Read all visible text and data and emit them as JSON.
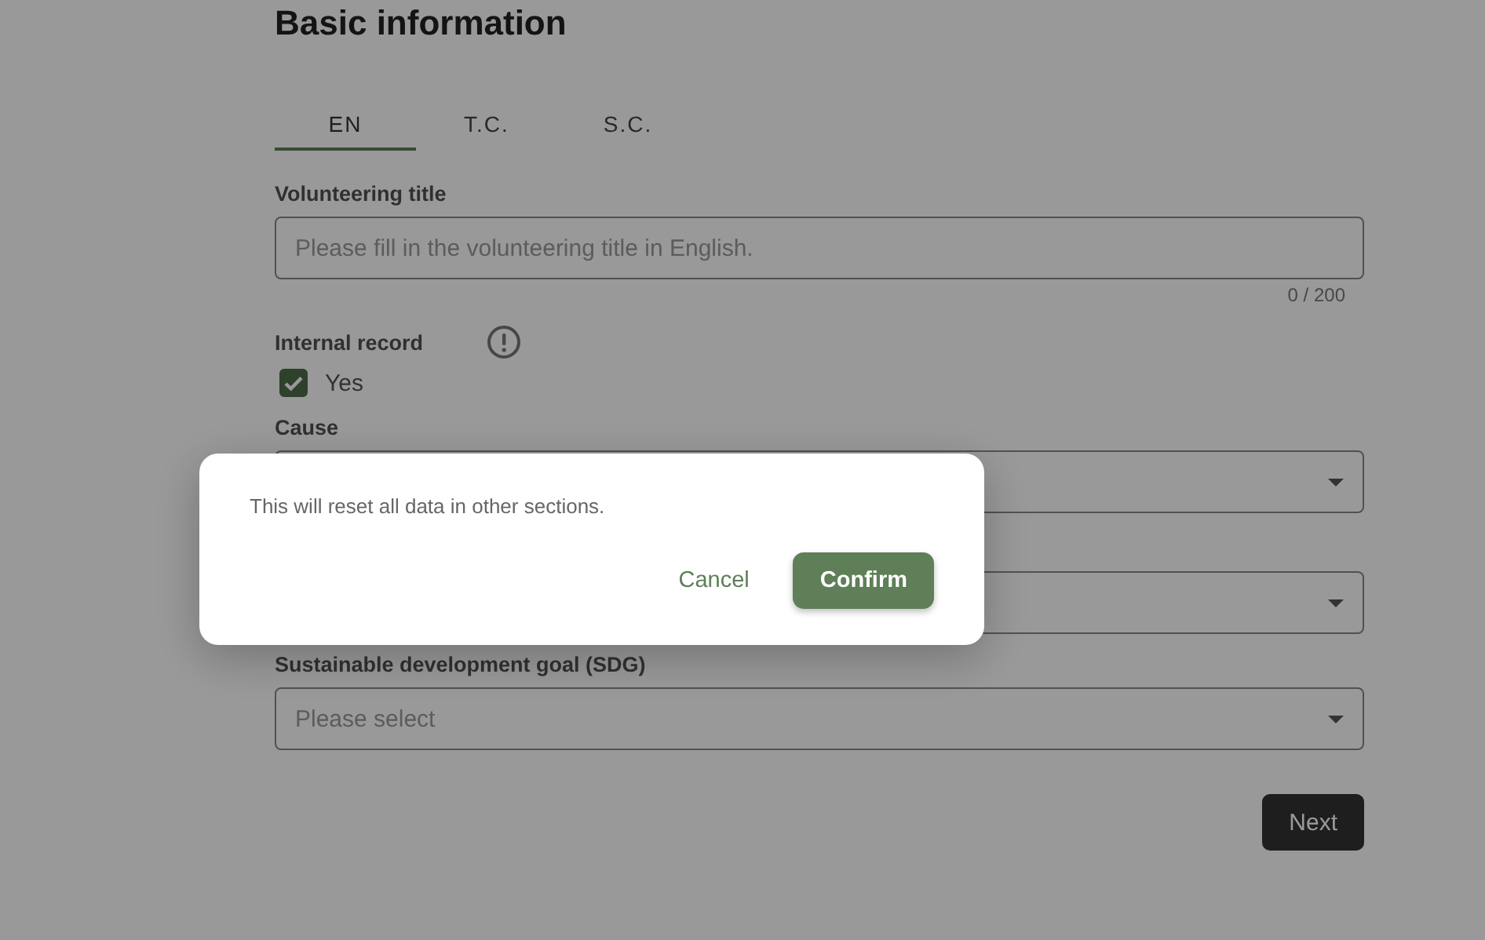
{
  "section": {
    "title": "Basic information"
  },
  "tabs": [
    {
      "label": "EN",
      "selected": true
    },
    {
      "label": "T.C.",
      "selected": false
    },
    {
      "label": "S.C.",
      "selected": false
    }
  ],
  "fields": [
    {
      "kind": "text",
      "label": "Volunteering title",
      "placeholder": "Please fill in the volunteering title in English.",
      "counter": "0 / 200"
    },
    {
      "kind": "checkbox",
      "label": "Internal record",
      "option": "Yes",
      "checked": true
    },
    {
      "kind": "select",
      "label": "Cause"
    },
    {
      "kind": "select"
    },
    {
      "kind": "select",
      "label": "Sustainable development goal (SDG)",
      "placeholder": "Please select"
    }
  ],
  "next_button": "Next",
  "dialog": {
    "message": "This will reset all data in other sections.",
    "cancel": "Cancel",
    "confirm": "Confirm"
  }
}
